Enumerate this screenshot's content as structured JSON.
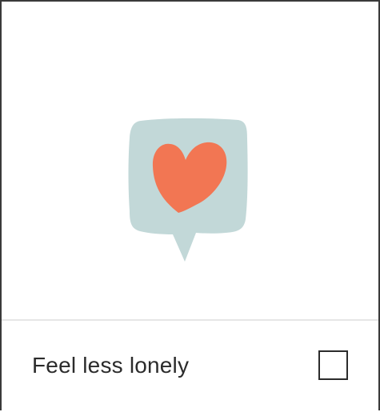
{
  "option": {
    "label": "Feel less lonely",
    "checked": false
  },
  "illustration": {
    "icon": "heart-speech-bubble-icon",
    "bubble_color": "#c2d8d8",
    "heart_color": "#f27653"
  },
  "colors": {
    "border": "#3a3a3a",
    "divider": "#e6e6e6",
    "text": "#2b2b2b"
  }
}
